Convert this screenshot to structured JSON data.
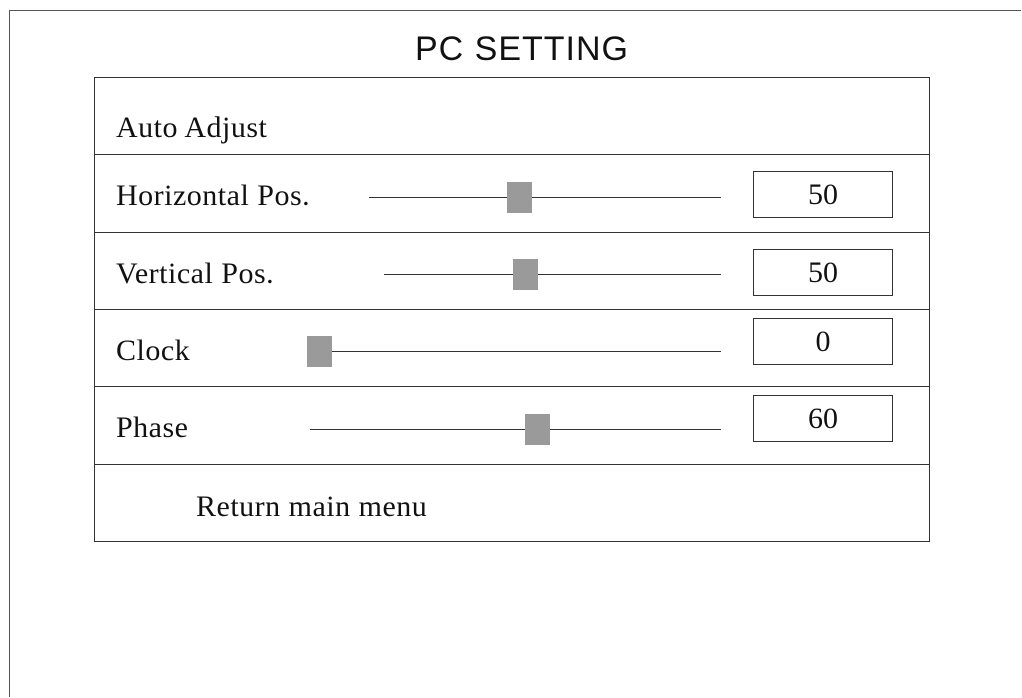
{
  "screen": {
    "title": "PC SETTING"
  },
  "menu": {
    "auto_adjust": "Auto Adjust",
    "items": [
      {
        "label": "Horizontal Pos.",
        "value": "50",
        "level": 50
      },
      {
        "label": "Vertical Pos.",
        "value": "50",
        "level": 50
      },
      {
        "label": "Clock",
        "value": "0",
        "level": 0
      },
      {
        "label": "Phase",
        "value": "60",
        "level": 60
      }
    ],
    "return_label": "Return main menu"
  },
  "colors": {
    "thumb": "#9a9a9a",
    "line": "#333333"
  }
}
